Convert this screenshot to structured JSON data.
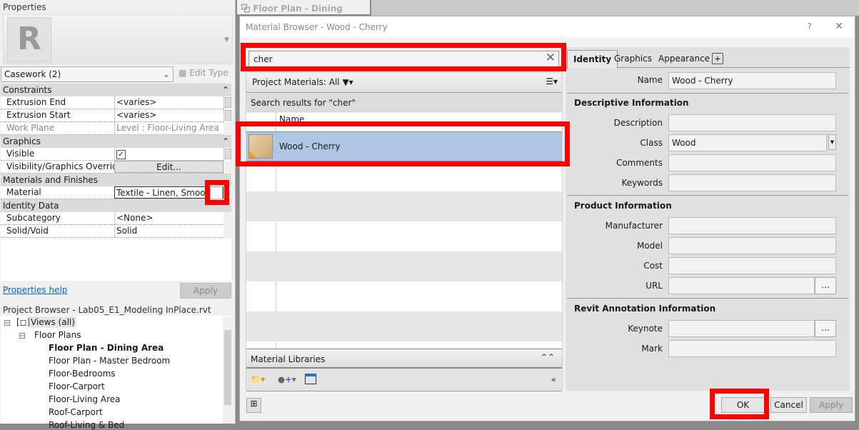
{
  "properties": {
    "title": "Properties",
    "type_selector": "Casework (2)",
    "edit_type": "Edit Type",
    "groups": [
      {
        "name": "Constraints",
        "rows": [
          {
            "key": "Extrusion End",
            "value": "<varies>"
          },
          {
            "key": "Extrusion Start",
            "value": "<varies>"
          },
          {
            "key": "Work Plane",
            "value": "Level : Floor-Living Area",
            "disabled": true
          }
        ]
      },
      {
        "name": "Graphics",
        "rows": [
          {
            "key": "Visible",
            "value": "checked"
          },
          {
            "key": "Visibility/Graphics Overrides",
            "value": "Edit..."
          }
        ]
      },
      {
        "name": "Materials and Finishes",
        "rows": [
          {
            "key": "Material",
            "value": "Textile - Linen, Smooth"
          }
        ]
      },
      {
        "name": "Identity Data",
        "rows": [
          {
            "key": "Subcategory",
            "value": "<None>"
          },
          {
            "key": "Solid/Void",
            "value": "Solid"
          }
        ]
      }
    ],
    "help_link": "Properties help",
    "apply": "Apply"
  },
  "project_browser": {
    "title": "Project Browser - Lab05_E1_Modeling InPlace.rvt",
    "root": "Views (all)",
    "folder": "Floor Plans",
    "items": [
      "Floor Plan - Dining Area",
      "Floor Plan - Master Bedroom",
      "Floor-Bedrooms",
      "Floor-Carport",
      "Floor-Living Area",
      "Roof-Carport",
      "Roof-Living & Bed"
    ]
  },
  "view_tab": {
    "label": "Floor Plan - Dining Area"
  },
  "dialog": {
    "title": "Material Browser - Wood - Cherry",
    "help": "?",
    "search_value": "cher",
    "filter_label": "Project Materials: All",
    "search_results": "Search results for \"cher\"",
    "column_name": "Name",
    "result": "Wood - Cherry",
    "material_libraries": "Material Libraries",
    "tabs": [
      "Identity",
      "Graphics",
      "Appearance"
    ],
    "active_tab": "Identity",
    "name_label": "Name",
    "name_value": "Wood - Cherry",
    "sections": {
      "descriptive": "Descriptive Information",
      "product": "Product Information",
      "annotation": "Revit Annotation Information"
    },
    "fields": {
      "description": {
        "label": "Description",
        "value": ""
      },
      "class": {
        "label": "Class",
        "value": "Wood"
      },
      "comments": {
        "label": "Comments",
        "value": ""
      },
      "keywords": {
        "label": "Keywords",
        "value": ""
      },
      "manufacturer": {
        "label": "Manufacturer",
        "value": ""
      },
      "model": {
        "label": "Model",
        "value": ""
      },
      "cost": {
        "label": "Cost",
        "value": ""
      },
      "url": {
        "label": "URL",
        "value": ""
      },
      "keynote": {
        "label": "Keynote",
        "value": ""
      },
      "mark": {
        "label": "Mark",
        "value": ""
      }
    },
    "ok": "OK",
    "cancel": "Cancel",
    "apply": "Apply"
  },
  "colors": {
    "highlight": "#ff0000",
    "selection": "#aec6e4"
  }
}
